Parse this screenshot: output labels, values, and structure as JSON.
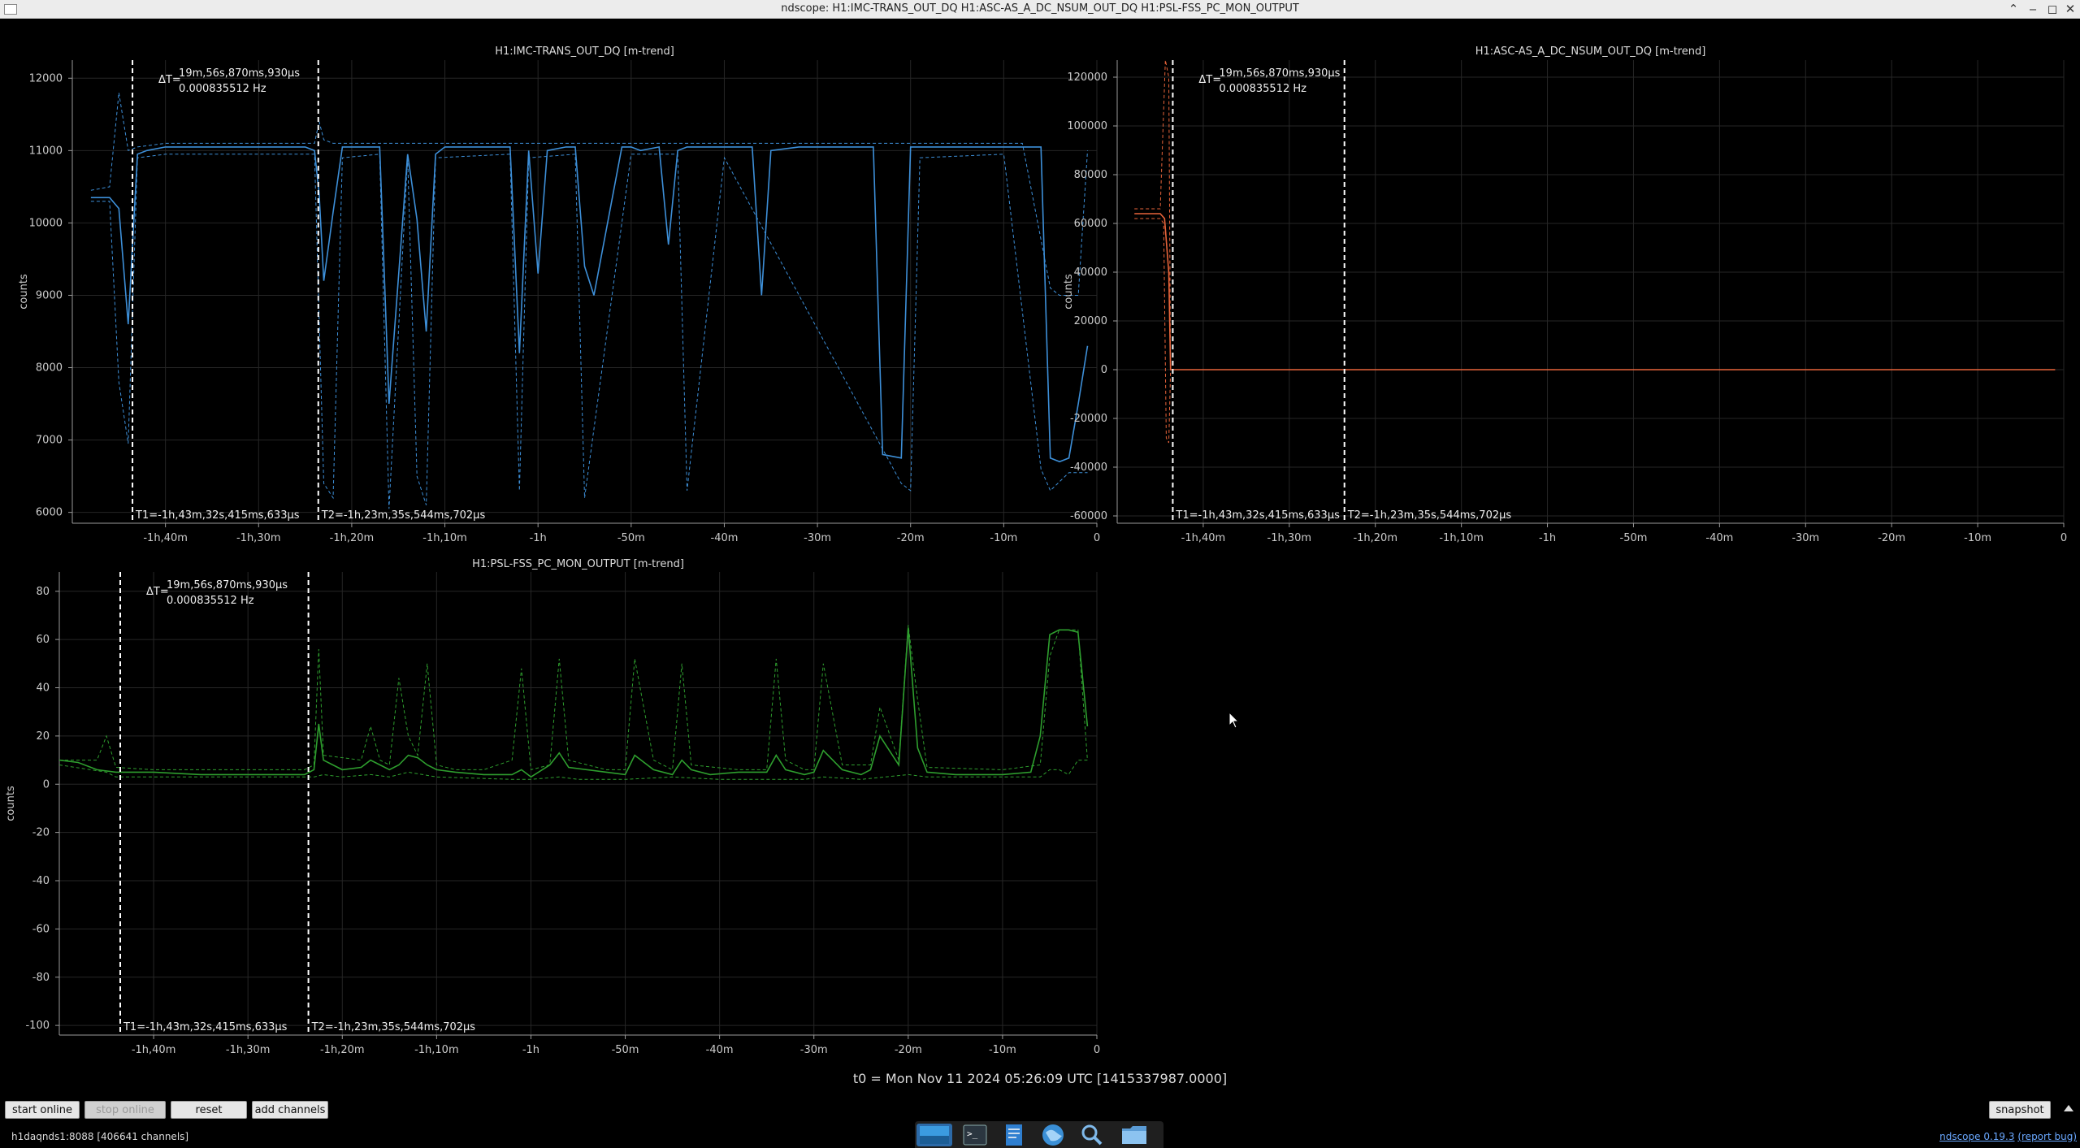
{
  "window": {
    "title": "ndscope: H1:IMC-TRANS_OUT_DQ H1:ASC-AS_A_DC_NSUM_OUT_DQ H1:PSL-FSS_PC_MON_OUTPUT",
    "controls": [
      "minimize-icon",
      "maximize-icon",
      "close-icon"
    ]
  },
  "cursors": {
    "delta_label": "ΔT=",
    "delta_time": "19m,56s,870ms,930µs",
    "delta_freq": "0.000835512 Hz",
    "t1_label": "T1=-1h,43m,32s,415ms,633µs",
    "t2_label": "T2=-1h,23m,35s,544ms,702µs",
    "t1_value": -103.54,
    "t2_value": -83.59
  },
  "x_axis": {
    "range": [
      -110,
      0
    ],
    "ticks": [
      {
        "v": -100,
        "label": "-1h,40m"
      },
      {
        "v": -90,
        "label": "-1h,30m"
      },
      {
        "v": -80,
        "label": "-1h,20m"
      },
      {
        "v": -70,
        "label": "-1h,10m"
      },
      {
        "v": -60,
        "label": "-1h"
      },
      {
        "v": -50,
        "label": "-50m"
      },
      {
        "v": -40,
        "label": "-40m"
      },
      {
        "v": -30,
        "label": "-30m"
      },
      {
        "v": -20,
        "label": "-20m"
      },
      {
        "v": -10,
        "label": "-10m"
      },
      {
        "v": 0,
        "label": "0"
      }
    ]
  },
  "colors": {
    "imc": "#3d8fd8",
    "asc": "#e8643a",
    "psl": "#2e9e2e",
    "cursor": "#ffffff",
    "background": "#000000"
  },
  "chart_data": [
    {
      "type": "line",
      "title": "H1:IMC-TRANS_OUT_DQ [m-trend]",
      "ylabel": "counts",
      "ylim": [
        5850,
        12250
      ],
      "yticks": [
        6000,
        7000,
        8000,
        9000,
        10000,
        11000,
        12000
      ],
      "series": [
        {
          "role": "mean",
          "x": [
            -108,
            -106,
            -105,
            -104,
            -103,
            -102,
            -100,
            -95,
            -90,
            -85,
            -84,
            -83.5,
            -83,
            -82,
            -81,
            -77,
            -76,
            -74,
            -73,
            -72,
            -71,
            -70,
            -69,
            -65,
            -63,
            -62,
            -61,
            -60,
            -59,
            -57,
            -56,
            -55,
            -54,
            -51,
            -50,
            -49,
            -47,
            -46,
            -45,
            -44,
            -43,
            -41,
            -40,
            -39,
            -37,
            -36,
            -35,
            -32,
            -31,
            -30,
            -29,
            -28,
            -25,
            -24,
            -23,
            -21,
            -20,
            -19,
            -18,
            -17,
            -15,
            -6,
            -5,
            -4,
            -3,
            -2,
            -1
          ],
          "y": [
            10350,
            10350,
            10200,
            8600,
            10950,
            11000,
            11050,
            11050,
            11050,
            11050,
            11000,
            10400,
            9200,
            10150,
            11050,
            11050,
            7500,
            10950,
            10050,
            8500,
            10950,
            11050,
            11050,
            11050,
            11050,
            8200,
            11000,
            9300,
            11000,
            11050,
            11050,
            9400,
            9000,
            11050,
            11050,
            11000,
            11050,
            9700,
            11000,
            11050,
            11050,
            11050,
            11050,
            11050,
            11050,
            9000,
            11000,
            11050,
            11050,
            11050,
            11050,
            11050,
            11050,
            11050,
            6800,
            6750,
            11050,
            11050,
            11050,
            11050,
            11050,
            11050,
            6750,
            6700,
            6750,
            7500,
            8300
          ]
        },
        {
          "role": "max",
          "x": [
            -108,
            -106,
            -105,
            -104,
            -103,
            -100,
            -90,
            -84,
            -83.5,
            -83,
            -82,
            -81,
            -60,
            -20,
            -8,
            -5,
            -4,
            -2,
            -1
          ],
          "y": [
            10450,
            10500,
            11800,
            11000,
            11050,
            11100,
            11100,
            11100,
            11400,
            11150,
            11100,
            11100,
            11100,
            11100,
            11100,
            9100,
            9000,
            9000,
            11000
          ]
        },
        {
          "role": "min",
          "x": [
            -108,
            -106,
            -105,
            -104,
            -103,
            -100,
            -90,
            -84,
            -83,
            -82,
            -81,
            -77,
            -76,
            -74,
            -73,
            -72,
            -71,
            -63,
            -62,
            -61,
            -56,
            -55,
            -50,
            -45,
            -44,
            -40,
            -21,
            -20,
            -19,
            -10,
            -6,
            -5,
            -3,
            -1
          ],
          "y": [
            10300,
            10300,
            7800,
            6950,
            10900,
            10950,
            10950,
            10950,
            6400,
            6200,
            10900,
            10950,
            6050,
            10900,
            6500,
            6100,
            10900,
            10950,
            6300,
            10900,
            10950,
            6200,
            10950,
            10950,
            6300,
            10900,
            6400,
            6300,
            10900,
            10950,
            6600,
            6300,
            6550,
            6550
          ]
        }
      ]
    },
    {
      "type": "line",
      "title": "H1:ASC-AS_A_DC_NSUM_OUT_DQ [m-trend]",
      "ylabel": "counts",
      "ylim": [
        -63000,
        127000
      ],
      "yticks": [
        -60000,
        -40000,
        -20000,
        0,
        20000,
        40000,
        60000,
        80000,
        100000,
        120000
      ],
      "series": [
        {
          "role": "mean",
          "x": [
            -108,
            -105,
            -104.5,
            -104,
            -103.8,
            -103.6,
            -100,
            -80,
            -60,
            -40,
            -20,
            -1
          ],
          "y": [
            64000,
            64000,
            62000,
            40000,
            0,
            0,
            0,
            0,
            0,
            0,
            0,
            0
          ]
        },
        {
          "role": "max",
          "x": [
            -108,
            -105,
            -104.4,
            -104,
            -103.8
          ],
          "y": [
            66000,
            66000,
            127000,
            120000,
            0
          ]
        },
        {
          "role": "min",
          "x": [
            -108,
            -105,
            -104.6,
            -104.3,
            -104,
            -103.8
          ],
          "y": [
            62000,
            62000,
            60000,
            -28000,
            -30000,
            0
          ]
        }
      ]
    },
    {
      "type": "line",
      "title": "H1:PSL-FSS_PC_MON_OUTPUT [m-trend]",
      "ylabel": "counts",
      "ylim": [
        -104,
        88
      ],
      "yticks": [
        -100,
        -80,
        -60,
        -40,
        -20,
        0,
        20,
        40,
        60,
        80
      ],
      "series": [
        {
          "role": "mean",
          "x": [
            -110,
            -108,
            -106,
            -104,
            -102,
            -100,
            -95,
            -90,
            -85,
            -84,
            -83,
            -82.5,
            -82,
            -80,
            -78,
            -77,
            -76,
            -75,
            -74,
            -73,
            -72,
            -71,
            -70,
            -68,
            -65,
            -62,
            -61,
            -60,
            -58,
            -57,
            -56,
            -52,
            -50,
            -49,
            -47,
            -45,
            -44,
            -43,
            -41,
            -38,
            -35,
            -34,
            -33,
            -31,
            -30,
            -29,
            -27,
            -25,
            -24,
            -23,
            -21,
            -20,
            -19,
            -18,
            -15,
            -10,
            -7,
            -6,
            -5,
            -4,
            -3,
            -2,
            -1
          ],
          "y": [
            10,
            9,
            6,
            5,
            5,
            5,
            4,
            4,
            4,
            4,
            6,
            25,
            10,
            6,
            7,
            10,
            8,
            6,
            8,
            12,
            11,
            8,
            6,
            5,
            4,
            4,
            6,
            3,
            8,
            13,
            7,
            5,
            4,
            12,
            6,
            4,
            10,
            6,
            4,
            5,
            5,
            12,
            6,
            4,
            5,
            14,
            6,
            4,
            6,
            20,
            8,
            65,
            15,
            5,
            4,
            4,
            5,
            20,
            62,
            64,
            64,
            63,
            24
          ]
        },
        {
          "role": "max",
          "x": [
            -110,
            -106,
            -105,
            -104,
            -100,
            -90,
            -84,
            -83,
            -82.5,
            -82,
            -78,
            -77,
            -76,
            -75,
            -74,
            -73,
            -72,
            -71,
            -70,
            -68,
            -65,
            -62,
            -61,
            -60,
            -58,
            -57,
            -56,
            -52,
            -50,
            -49,
            -47,
            -45,
            -44,
            -43,
            -38,
            -35,
            -34,
            -33,
            -31,
            -30,
            -29,
            -27,
            -24,
            -23,
            -21,
            -20,
            -19,
            -18,
            -10,
            -6,
            -5,
            -4,
            -2,
            -1
          ],
          "y": [
            10,
            10,
            20,
            7,
            6,
            6,
            6,
            8,
            56,
            12,
            10,
            24,
            10,
            8,
            44,
            20,
            12,
            50,
            8,
            6,
            6,
            10,
            48,
            6,
            8,
            52,
            10,
            6,
            6,
            52,
            10,
            6,
            50,
            8,
            6,
            6,
            52,
            10,
            6,
            6,
            50,
            8,
            8,
            32,
            10,
            66,
            35,
            7,
            6,
            8,
            53,
            64,
            64,
            10
          ]
        },
        {
          "role": "min",
          "x": [
            -110,
            -105,
            -104,
            -100,
            -84,
            -83,
            -82,
            -80,
            -77,
            -75,
            -73,
            -70,
            -62,
            -60,
            -57,
            -55,
            -50,
            -45,
            -40,
            -35,
            -31,
            -29,
            -25,
            -20,
            -18,
            -10,
            -6,
            -5,
            -4,
            -3,
            -2,
            -1
          ],
          "y": [
            8,
            5,
            3,
            3,
            3,
            3,
            4,
            3,
            4,
            3,
            5,
            3,
            2,
            2,
            3,
            2,
            2,
            3,
            2,
            2,
            2,
            3,
            2,
            4,
            3,
            3,
            3,
            6,
            6,
            4,
            10,
            10
          ]
        }
      ]
    }
  ],
  "t0_label": "t0 = Mon Nov 11 2024 05:26:09 UTC [1415337987.0000]",
  "toolbar": {
    "start_online": "start online",
    "stop_online": "stop online",
    "reset": "reset",
    "add_channels": "add channels",
    "snapshot": "snapshot"
  },
  "status": {
    "server": "h1daqnds1:8088",
    "channels": "[406641 channels]",
    "version": "ndscope 0.19.3",
    "report_bug": "(report bug)"
  },
  "dock": {
    "items": [
      "desktop-icon",
      "terminal-icon",
      "text-editor-icon",
      "browser-icon",
      "search-icon",
      "folder-icon"
    ],
    "active": "desktop-icon"
  }
}
